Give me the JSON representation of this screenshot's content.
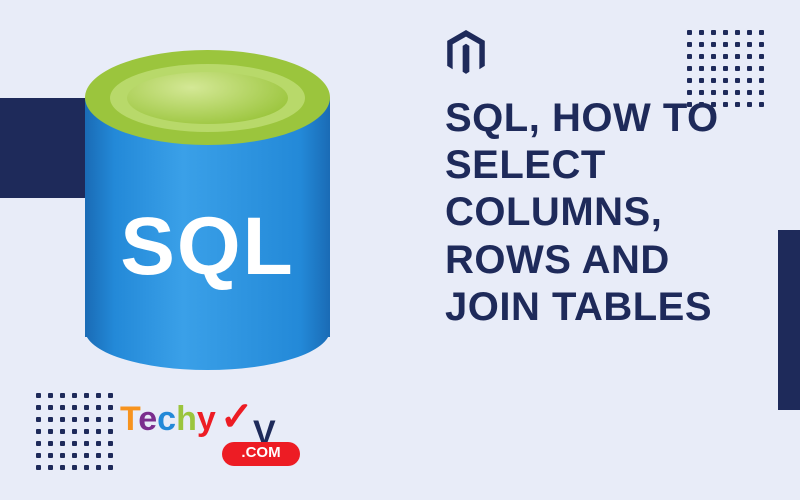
{
  "cylinder": {
    "label": "SQL"
  },
  "headline": {
    "text": "SQL, HOW TO SELECT COLUMNS, ROWS AND JOIN TABLES"
  },
  "logo": {
    "letters": [
      "T",
      "e",
      "c",
      "h",
      "y",
      "V"
    ],
    "suffix": ".COM",
    "checkmark": "✓"
  },
  "icons": {
    "hex": "magento-icon"
  },
  "colors": {
    "navy": "#1e2a5a",
    "bg": "#e8ecf8",
    "green": "#9bc53d",
    "blue": "#2389d8",
    "red": "#ed1c24"
  }
}
